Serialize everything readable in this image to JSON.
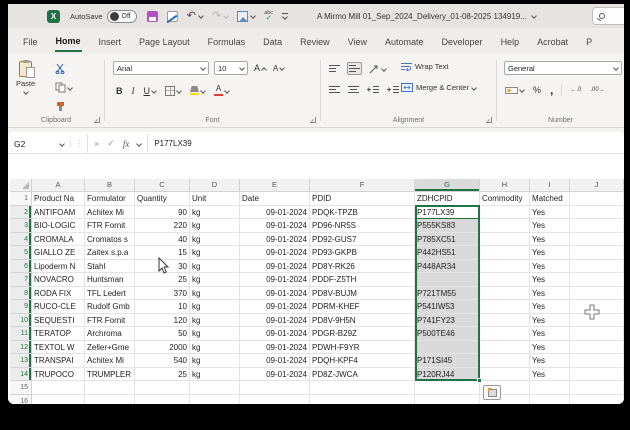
{
  "title_bar": {
    "excel_logo": "X",
    "autosave_label": "AutoSave",
    "autosave_state": "Off",
    "document_title": "A Mirmo Mill 01_Sep_2024_Delivery_01-08-2025 134919..."
  },
  "ribbon_tabs": [
    "File",
    "Home",
    "Insert",
    "Page Layout",
    "Formulas",
    "Data",
    "Review",
    "View",
    "Automate",
    "Developer",
    "Help",
    "Acrobat",
    "P"
  ],
  "active_tab": "Home",
  "ribbon": {
    "clipboard": {
      "paste_label": "Paste",
      "group_label": "Clipboard"
    },
    "font": {
      "font_name": "Arial",
      "font_size": "10",
      "bold": "B",
      "italic": "I",
      "underline": "U",
      "grow_font": "A",
      "shrink_font": "A",
      "font_color_letter": "A",
      "group_label": "Font"
    },
    "alignment": {
      "wrap_text_label": "Wrap Text",
      "merge_center_label": "Merge & Center",
      "group_label": "Alignment"
    },
    "number": {
      "format": "General",
      "percent": "%",
      "comma": ",",
      "inc_decimal": "←.0",
      "dec_decimal": ".00→",
      "group_label": "Number"
    }
  },
  "formula_bar": {
    "name_box": "G2",
    "cancel": "×",
    "enter": "✓",
    "fx": "fx",
    "content": "P177LX39"
  },
  "sheet": {
    "col_letters": [
      "A",
      "B",
      "C",
      "D",
      "E",
      "F",
      "G",
      "H",
      "I",
      "J"
    ],
    "selection": {
      "range": "G2:G14",
      "active_cell": "G2"
    },
    "rows": [
      {
        "n": "1",
        "cells": [
          "Product Na",
          "Formulator",
          "Quantity",
          "Unit",
          "Date",
          "PDID",
          "ZDHCPID",
          "Commodity",
          "Matched"
        ]
      },
      {
        "n": "2",
        "cells": [
          "ANTIFOAM",
          "Achitex Mi",
          "90",
          "kg",
          "09-01-2024",
          "PDQK-TPZB",
          "P177LX39",
          "",
          "Yes"
        ]
      },
      {
        "n": "3",
        "cells": [
          "BIO-LOGIC",
          "FTR Fornit",
          "220",
          "kg",
          "09-01-2024",
          "PD96-NR5S",
          "P555KS83",
          "",
          "Yes"
        ]
      },
      {
        "n": "4",
        "cells": [
          "CROMALA",
          "Cromatos s",
          "40",
          "kg",
          "09-01-2024",
          "PD92-GUS7",
          "P785XC51",
          "",
          "Yes"
        ]
      },
      {
        "n": "5",
        "cells": [
          "GIALLO ZE",
          "Zaitex s.p.a",
          "15",
          "kg",
          "09-01-2024",
          "PD93-GKPB",
          "P442HS51",
          "",
          "Yes"
        ]
      },
      {
        "n": "6",
        "cells": [
          "Lipoderm N",
          "Stahl",
          "30",
          "kg",
          "09-01-2024",
          "PD8Y-RK26",
          "P448AR34",
          "",
          "Yes"
        ]
      },
      {
        "n": "7",
        "cells": [
          "NOVACRO",
          "Huntsman",
          "25",
          "kg",
          "09-01-2024",
          "PDDF-Z5TH",
          "",
          "",
          "Yes"
        ]
      },
      {
        "n": "8",
        "cells": [
          "RODA FIX",
          "TFL Ledert",
          "370",
          "kg",
          "09-01-2024",
          "PD8V-BUJM",
          "P721TM55",
          "",
          "Yes"
        ]
      },
      {
        "n": "9",
        "cells": [
          "RUCO-CLE",
          "Rudolf Gmb",
          "10",
          "kg",
          "09-01-2024",
          "PDRM-KHEF",
          "P541IW53",
          "",
          "Yes"
        ]
      },
      {
        "n": "10",
        "cells": [
          "SEQUESTI",
          "FTR Fornit",
          "120",
          "kg",
          "09-01-2024",
          "PD8V-9H5N",
          "P741FY23",
          "",
          "Yes"
        ]
      },
      {
        "n": "11",
        "cells": [
          "TERATOP",
          "Archroma",
          "50",
          "kg",
          "09-01-2024",
          "PDGR-B29Z",
          "P500TE46",
          "",
          "Yes"
        ]
      },
      {
        "n": "12",
        "cells": [
          "TEXTOL W",
          "Zeller+Gme",
          "2000",
          "kg",
          "09-01-2024",
          "PDWH-F9YR",
          "",
          "",
          "Yes"
        ]
      },
      {
        "n": "13",
        "cells": [
          "TRANSPAI",
          "Achitex Mi",
          "540",
          "kg",
          "09-01-2024",
          "PDQH-KPF4",
          "P171SI45",
          "",
          "Yes"
        ]
      },
      {
        "n": "14",
        "cells": [
          "TRUPOCO",
          "TRUMPLER",
          "25",
          "kg",
          "09-01-2024",
          "PD8Z-JWCA",
          "P120RJ44",
          "",
          "Yes"
        ]
      },
      {
        "n": "15",
        "cells": [
          "",
          "",
          "",
          "",
          "",
          "",
          "",
          "",
          ""
        ]
      },
      {
        "n": "16",
        "cells": [
          "",
          "",
          "",
          "",
          "",
          "",
          "",
          "",
          ""
        ]
      }
    ]
  },
  "colors": {
    "accent_green": "#217346",
    "selection_fill": "#d9d9d9",
    "fill_color_swatch": "#ffd800",
    "font_color_swatch": "#e03c31"
  }
}
